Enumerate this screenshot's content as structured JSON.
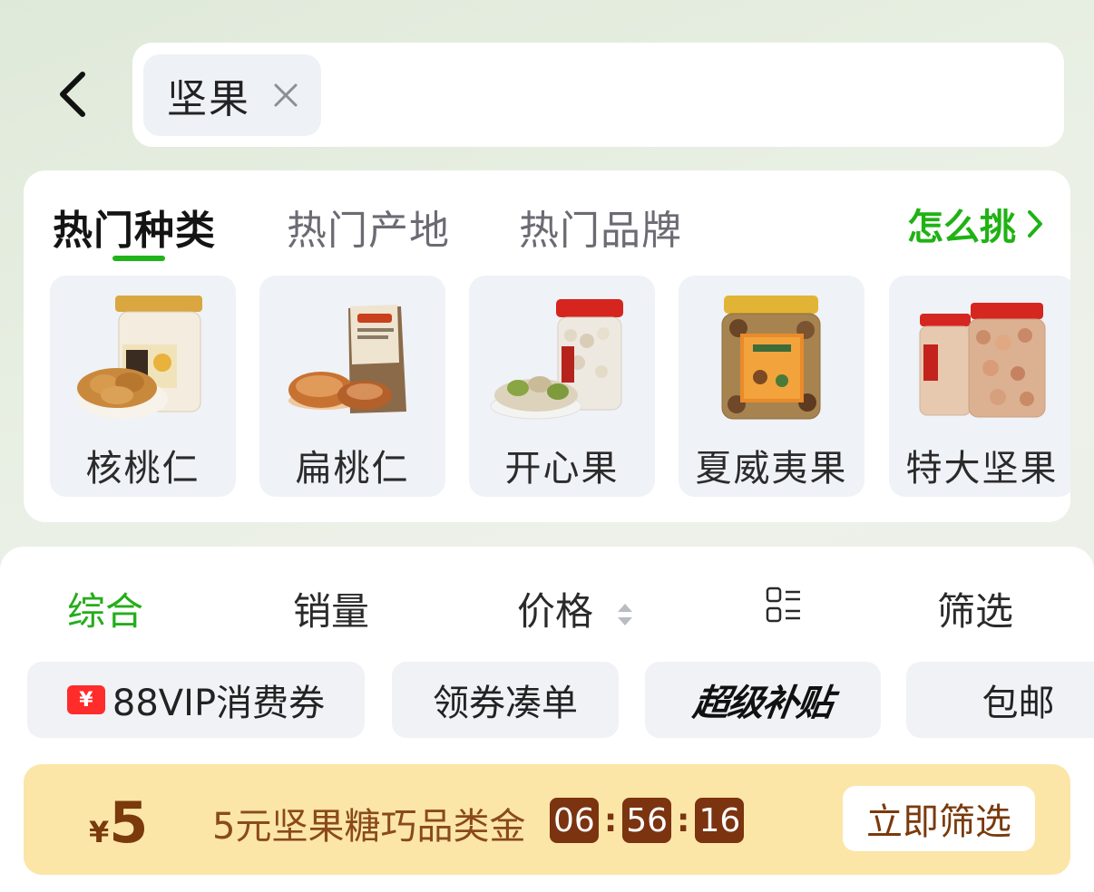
{
  "header": {
    "search_tag": "坚果"
  },
  "categories": {
    "tabs": [
      {
        "label": "热门种类",
        "active": true
      },
      {
        "label": "热门产地",
        "active": false
      },
      {
        "label": "热门品牌",
        "active": false
      }
    ],
    "how_to_pick": "怎么挑",
    "items": [
      {
        "label": "核桃仁",
        "icon": "walnut-jar-image"
      },
      {
        "label": "扁桃仁",
        "icon": "almond-bag-image"
      },
      {
        "label": "开心果",
        "icon": "pistachio-jar-image"
      },
      {
        "label": "夏威夷果",
        "icon": "macadamia-jar-image"
      },
      {
        "label": "特大坚果",
        "icon": "cashew-jar-image"
      }
    ]
  },
  "sort_bar": {
    "comprehensive": "综合",
    "sales": "销量",
    "price": "价格",
    "filter": "筛选"
  },
  "chips": {
    "vip_coupon_icon": "¥",
    "vip_coupon": "88VIP消费券",
    "combine_coupon": "领券凑单",
    "super_subsidy": "超级补贴",
    "free_shipping": "包邮"
  },
  "promo": {
    "currency": "¥",
    "amount": "5",
    "text": "5元坚果糖巧品类金",
    "timer": {
      "hours": "06",
      "minutes": "56",
      "seconds": "16"
    },
    "button": "立即筛选"
  },
  "colors": {
    "accent_green": "#20b214",
    "promo_bg": "#fbe6a8",
    "promo_brown": "#7b3310",
    "coupon_red": "#ff2c2c"
  }
}
